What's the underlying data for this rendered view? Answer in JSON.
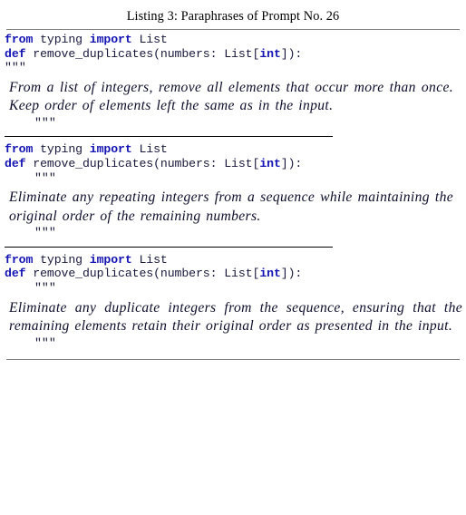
{
  "caption": "Listing 3: Paraphrases of Prompt No. 26",
  "colors": {
    "keyword": "#1414b4",
    "code_text": "#18183c",
    "doc_text": "#0d0d2b",
    "outer_rule": "#808080",
    "inner_rule": "#000000",
    "background": "#ffffff"
  },
  "code": {
    "import_line": {
      "kw_from": "from",
      "module": " typing ",
      "kw_import": "import",
      "name": " List"
    },
    "def_line": {
      "kw_def": "def",
      "signature": " remove_duplicates(numbers: List[",
      "kw_int": "int",
      "tail": "]):"
    },
    "triple_quote": "\"\"\""
  },
  "blocks": [
    {
      "id": "paraphrase-1",
      "open_quote_indented": false,
      "docstring": "From a list of integers, remove all elements that occur more than once. Keep order of elements left the same as in the input.",
      "close_quote": "\"\"\""
    },
    {
      "id": "paraphrase-2",
      "open_quote_indented": true,
      "docstring": "Eliminate any repeating integers from a sequence while maintaining the original order of the remaining numbers.",
      "close_quote": "\"\"\""
    },
    {
      "id": "paraphrase-3",
      "open_quote_indented": true,
      "docstring": "Eliminate any duplicate integers from the sequence, ensuring that the remaining elements retain their original order as presented in the input.",
      "close_quote": "\"\"\""
    }
  ]
}
